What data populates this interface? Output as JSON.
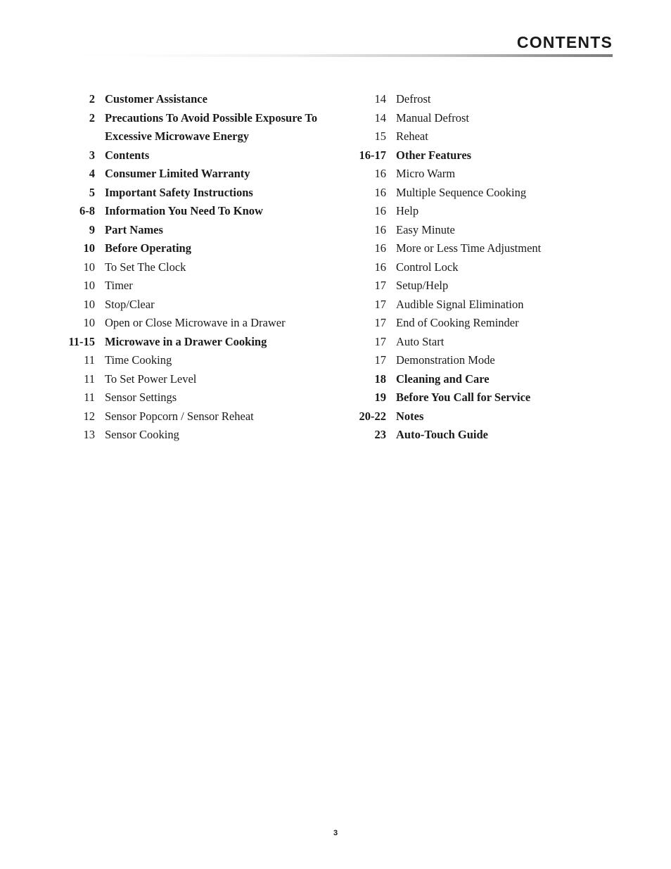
{
  "header": {
    "title": "CONTENTS"
  },
  "footer": {
    "page_number": "3"
  },
  "colors": {
    "text": "#1a1a1a",
    "rule_dark": "#7c7c7c",
    "page_background": "#ffffff"
  },
  "toc": {
    "left_column": [
      {
        "page": "2",
        "label": "Customer Assistance",
        "bold": true
      },
      {
        "page": "2",
        "label": "Precautions To Avoid Possible Exposure To",
        "bold": true
      },
      {
        "page": "",
        "label": "Excessive Microwave Energy",
        "bold": true,
        "continuation": true
      },
      {
        "page": "3",
        "label": "Contents",
        "bold": true
      },
      {
        "page": "4",
        "label": "Consumer Limited Warranty",
        "bold": true
      },
      {
        "page": "5",
        "label": "Important Safety Instructions",
        "bold": true
      },
      {
        "page": "6-8",
        "label": "Information You Need To Know",
        "bold": true
      },
      {
        "page": "9",
        "label": "Part Names",
        "bold": true
      },
      {
        "page": "10",
        "label": "Before Operating",
        "bold": true
      },
      {
        "page": "10",
        "label": "To Set The Clock",
        "bold": false
      },
      {
        "page": "10",
        "label": "Timer",
        "bold": false
      },
      {
        "page": "10",
        "label": "Stop/Clear",
        "bold": false
      },
      {
        "page": "10",
        "label": "Open or Close Microwave in a Drawer",
        "bold": false
      },
      {
        "page": "11-15",
        "label": "Microwave in a Drawer Cooking",
        "bold": true
      },
      {
        "page": "11",
        "label": "Time Cooking",
        "bold": false
      },
      {
        "page": "11",
        "label": "To Set Power Level",
        "bold": false
      },
      {
        "page": "11",
        "label": "Sensor Settings",
        "bold": false
      },
      {
        "page": "12",
        "label": "Sensor Popcorn / Sensor Reheat",
        "bold": false
      },
      {
        "page": "13",
        "label": "Sensor Cooking",
        "bold": false
      }
    ],
    "right_column": [
      {
        "page": "14",
        "label": "Defrost",
        "bold": false
      },
      {
        "page": "14",
        "label": "Manual Defrost",
        "bold": false
      },
      {
        "page": "15",
        "label": "Reheat",
        "bold": false
      },
      {
        "page": "16-17",
        "label": "Other Features",
        "bold": true
      },
      {
        "page": "16",
        "label": "Micro Warm",
        "bold": false
      },
      {
        "page": "16",
        "label": "Multiple Sequence Cooking",
        "bold": false
      },
      {
        "page": "16",
        "label": "Help",
        "bold": false
      },
      {
        "page": "16",
        "label": "Easy Minute",
        "bold": false
      },
      {
        "page": "16",
        "label": "More or Less Time Adjustment",
        "bold": false
      },
      {
        "page": "16",
        "label": "Control Lock",
        "bold": false
      },
      {
        "page": "17",
        "label": "Setup/Help",
        "bold": false
      },
      {
        "page": "17",
        "label": "Audible Signal Elimination",
        "bold": false
      },
      {
        "page": "17",
        "label": "End of Cooking Reminder",
        "bold": false
      },
      {
        "page": "17",
        "label": "Auto Start",
        "bold": false
      },
      {
        "page": "17",
        "label": "Demonstration Mode",
        "bold": false
      },
      {
        "page": "18",
        "label": "Cleaning and Care",
        "bold": true
      },
      {
        "page": "19",
        "label": "Before You Call for Service",
        "bold": true
      },
      {
        "page": "20-22",
        "label": "Notes",
        "bold": true
      },
      {
        "page": "23",
        "label": "Auto-Touch Guide",
        "bold": true
      }
    ]
  }
}
